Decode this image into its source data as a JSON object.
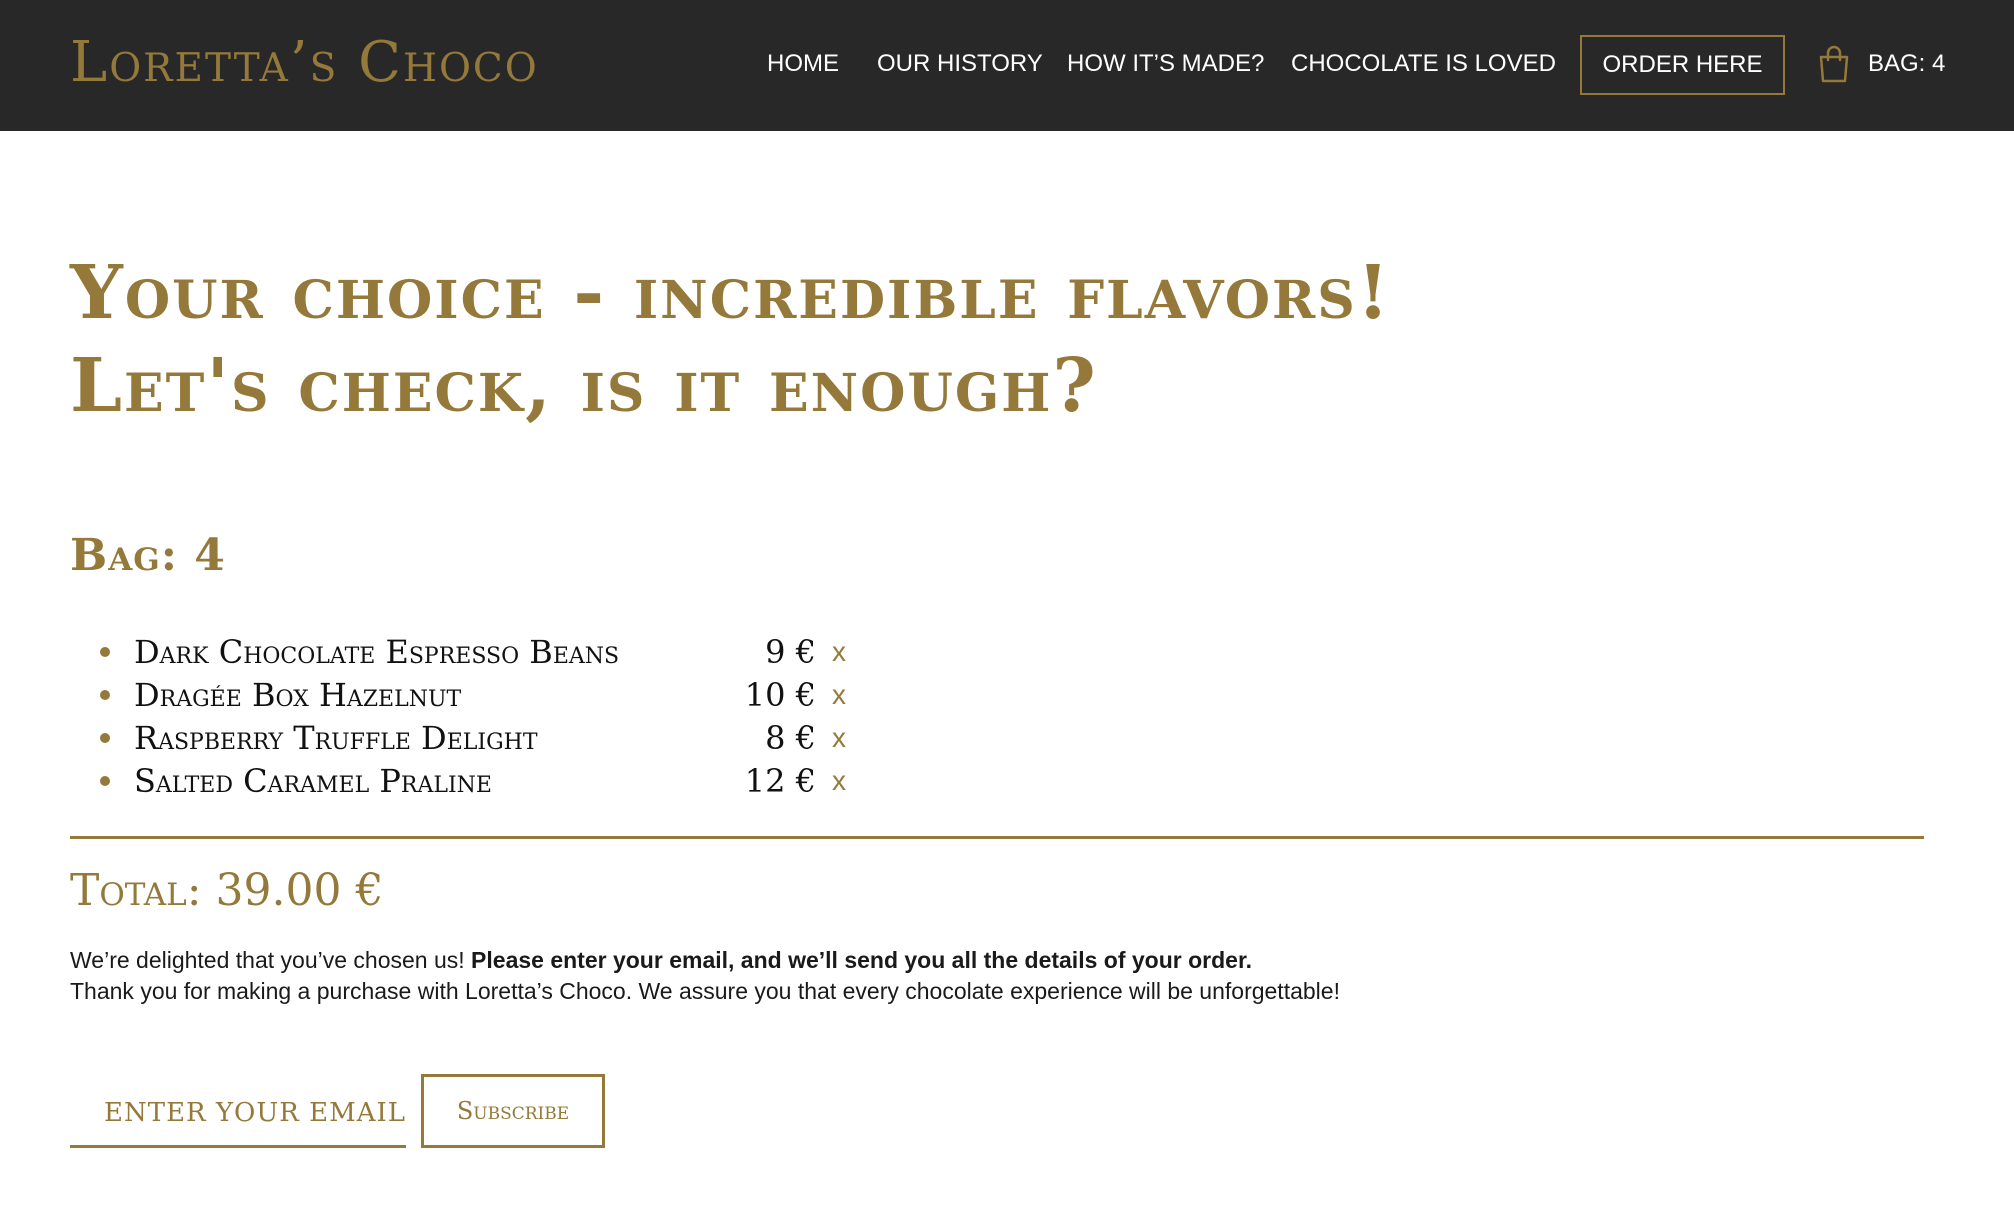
{
  "header": {
    "logo": "Loretta’s Choco",
    "nav": [
      {
        "label": "HOME"
      },
      {
        "label": "OUR HISTORY"
      },
      {
        "label": "HOW IT’S MADE?"
      },
      {
        "label": "CHOCOLATE IS LOVED"
      }
    ],
    "order_label": "ORDER HERE",
    "bag_label": "BAG: 4",
    "bag_icon": "shopping-bag-icon"
  },
  "main": {
    "heading_line1": "Your choice - incredible flavors!",
    "heading_line2": "Let's check, is it enough?",
    "bag_count": "Bag: 4",
    "items": [
      {
        "name": "Dark Chocolate Espresso Beans",
        "price": "9 €",
        "remove": "x"
      },
      {
        "name": "Dragée Box Hazelnut",
        "price": "10 €",
        "remove": "x"
      },
      {
        "name": "Raspberry Truffle Delight",
        "price": "8 €",
        "remove": "x"
      },
      {
        "name": "Salted Caramel Praline",
        "price": "12 €",
        "remove": "x"
      }
    ],
    "total": "Total: 39.00 €",
    "message_intro": "We’re delighted that you’ve chosen us! ",
    "message_bold": "Please enter your email, and we’ll send you all the details of your order.",
    "message_thanks": "Thank you for making a purchase with Loretta’s Choco. We assure you that every chocolate experience will be unforgettable!",
    "email_placeholder": "ENTER YOUR EMAIL",
    "subscribe_label": "Subscribe"
  },
  "colors": {
    "accent_gold": "#94793a",
    "navbar_bg": "#282828",
    "text_dark": "#1a1a1a"
  }
}
